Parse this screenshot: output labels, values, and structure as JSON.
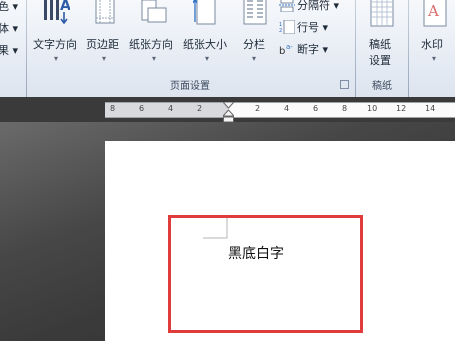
{
  "ribbon": {
    "left_partial": [
      "色 ▾",
      "体 ▾",
      "果 ▾"
    ],
    "page_setup": {
      "group_label": "页面设置",
      "buttons": [
        {
          "label": "文字方向"
        },
        {
          "label": "页边距"
        },
        {
          "label": "纸张方向"
        },
        {
          "label": "纸张大小"
        },
        {
          "label": "分栏"
        }
      ],
      "small_buttons": [
        {
          "label": "分隔符 ▾"
        },
        {
          "label": "行号 ▾"
        },
        {
          "label": "断字 ▾"
        }
      ]
    },
    "manuscript": {
      "group_label": "稿纸",
      "button_line1": "稿纸",
      "button_line2": "设置"
    },
    "watermark": {
      "label": "水印"
    }
  },
  "ruler": {
    "ticks": [
      "8",
      "6",
      "4",
      "2",
      "2",
      "4",
      "6",
      "8",
      "10",
      "12",
      "14"
    ]
  },
  "document": {
    "text": "黑底白字"
  },
  "colors": {
    "highlight": "#e03c3c",
    "page": "#ffffff",
    "workspace": "#3c3c3c"
  }
}
